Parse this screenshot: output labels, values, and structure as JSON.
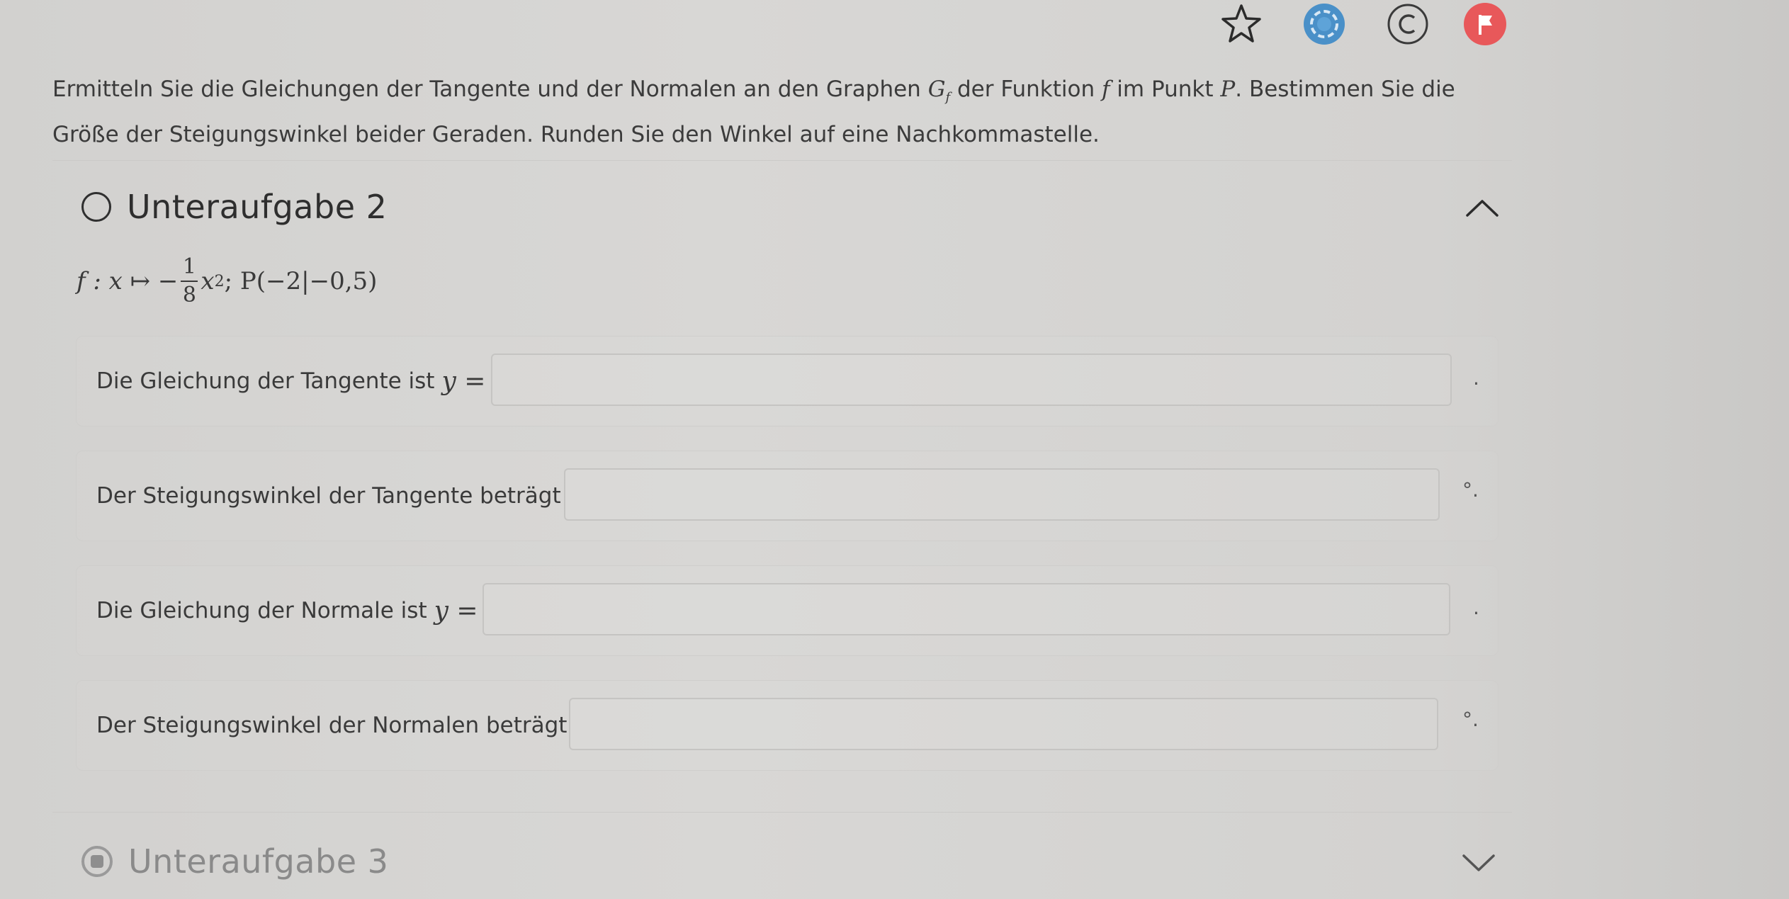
{
  "toolbar": {
    "icons": [
      "star-icon",
      "globe-icon",
      "copyright-icon",
      "flag-icon"
    ],
    "flag_color": "#e8585a",
    "globe_color": "#4a90c8"
  },
  "task": {
    "text_1": "Ermitteln Sie die Gleichungen der Tangente und der Normalen an den Graphen ",
    "graph_symbol": "G",
    "graph_sub": "f",
    "text_2": " der Funktion ",
    "func_symbol": "f",
    "text_3": " im Punkt ",
    "point_symbol": "P",
    "text_4": ". Bestimmen Sie die Größe der Steigungswinkel beider Geraden. Runden Sie den Winkel auf eine Nachkommastelle."
  },
  "subtask2": {
    "title": "Unteraufgabe 2",
    "function": {
      "lhs": "f : x ↦ −",
      "num": "1",
      "den": "8",
      "var": "x",
      "exp": "2",
      "rest": "; P(−2|−0,5)"
    },
    "rows": [
      {
        "label": "Die Gleichung der Tangente ist",
        "math": "y =",
        "value": "",
        "tail": "."
      },
      {
        "label": "Der Steigungswinkel der Tangente beträgt",
        "math": "",
        "value": "",
        "tail": "°."
      },
      {
        "label": "Die Gleichung der Normale ist",
        "math": "y =",
        "value": "",
        "tail": "."
      },
      {
        "label": "Der Steigungswinkel der Normalen beträgt",
        "math": "",
        "value": "",
        "tail": "°."
      }
    ]
  },
  "subtask3": {
    "title": "Unteraufgabe 3"
  }
}
